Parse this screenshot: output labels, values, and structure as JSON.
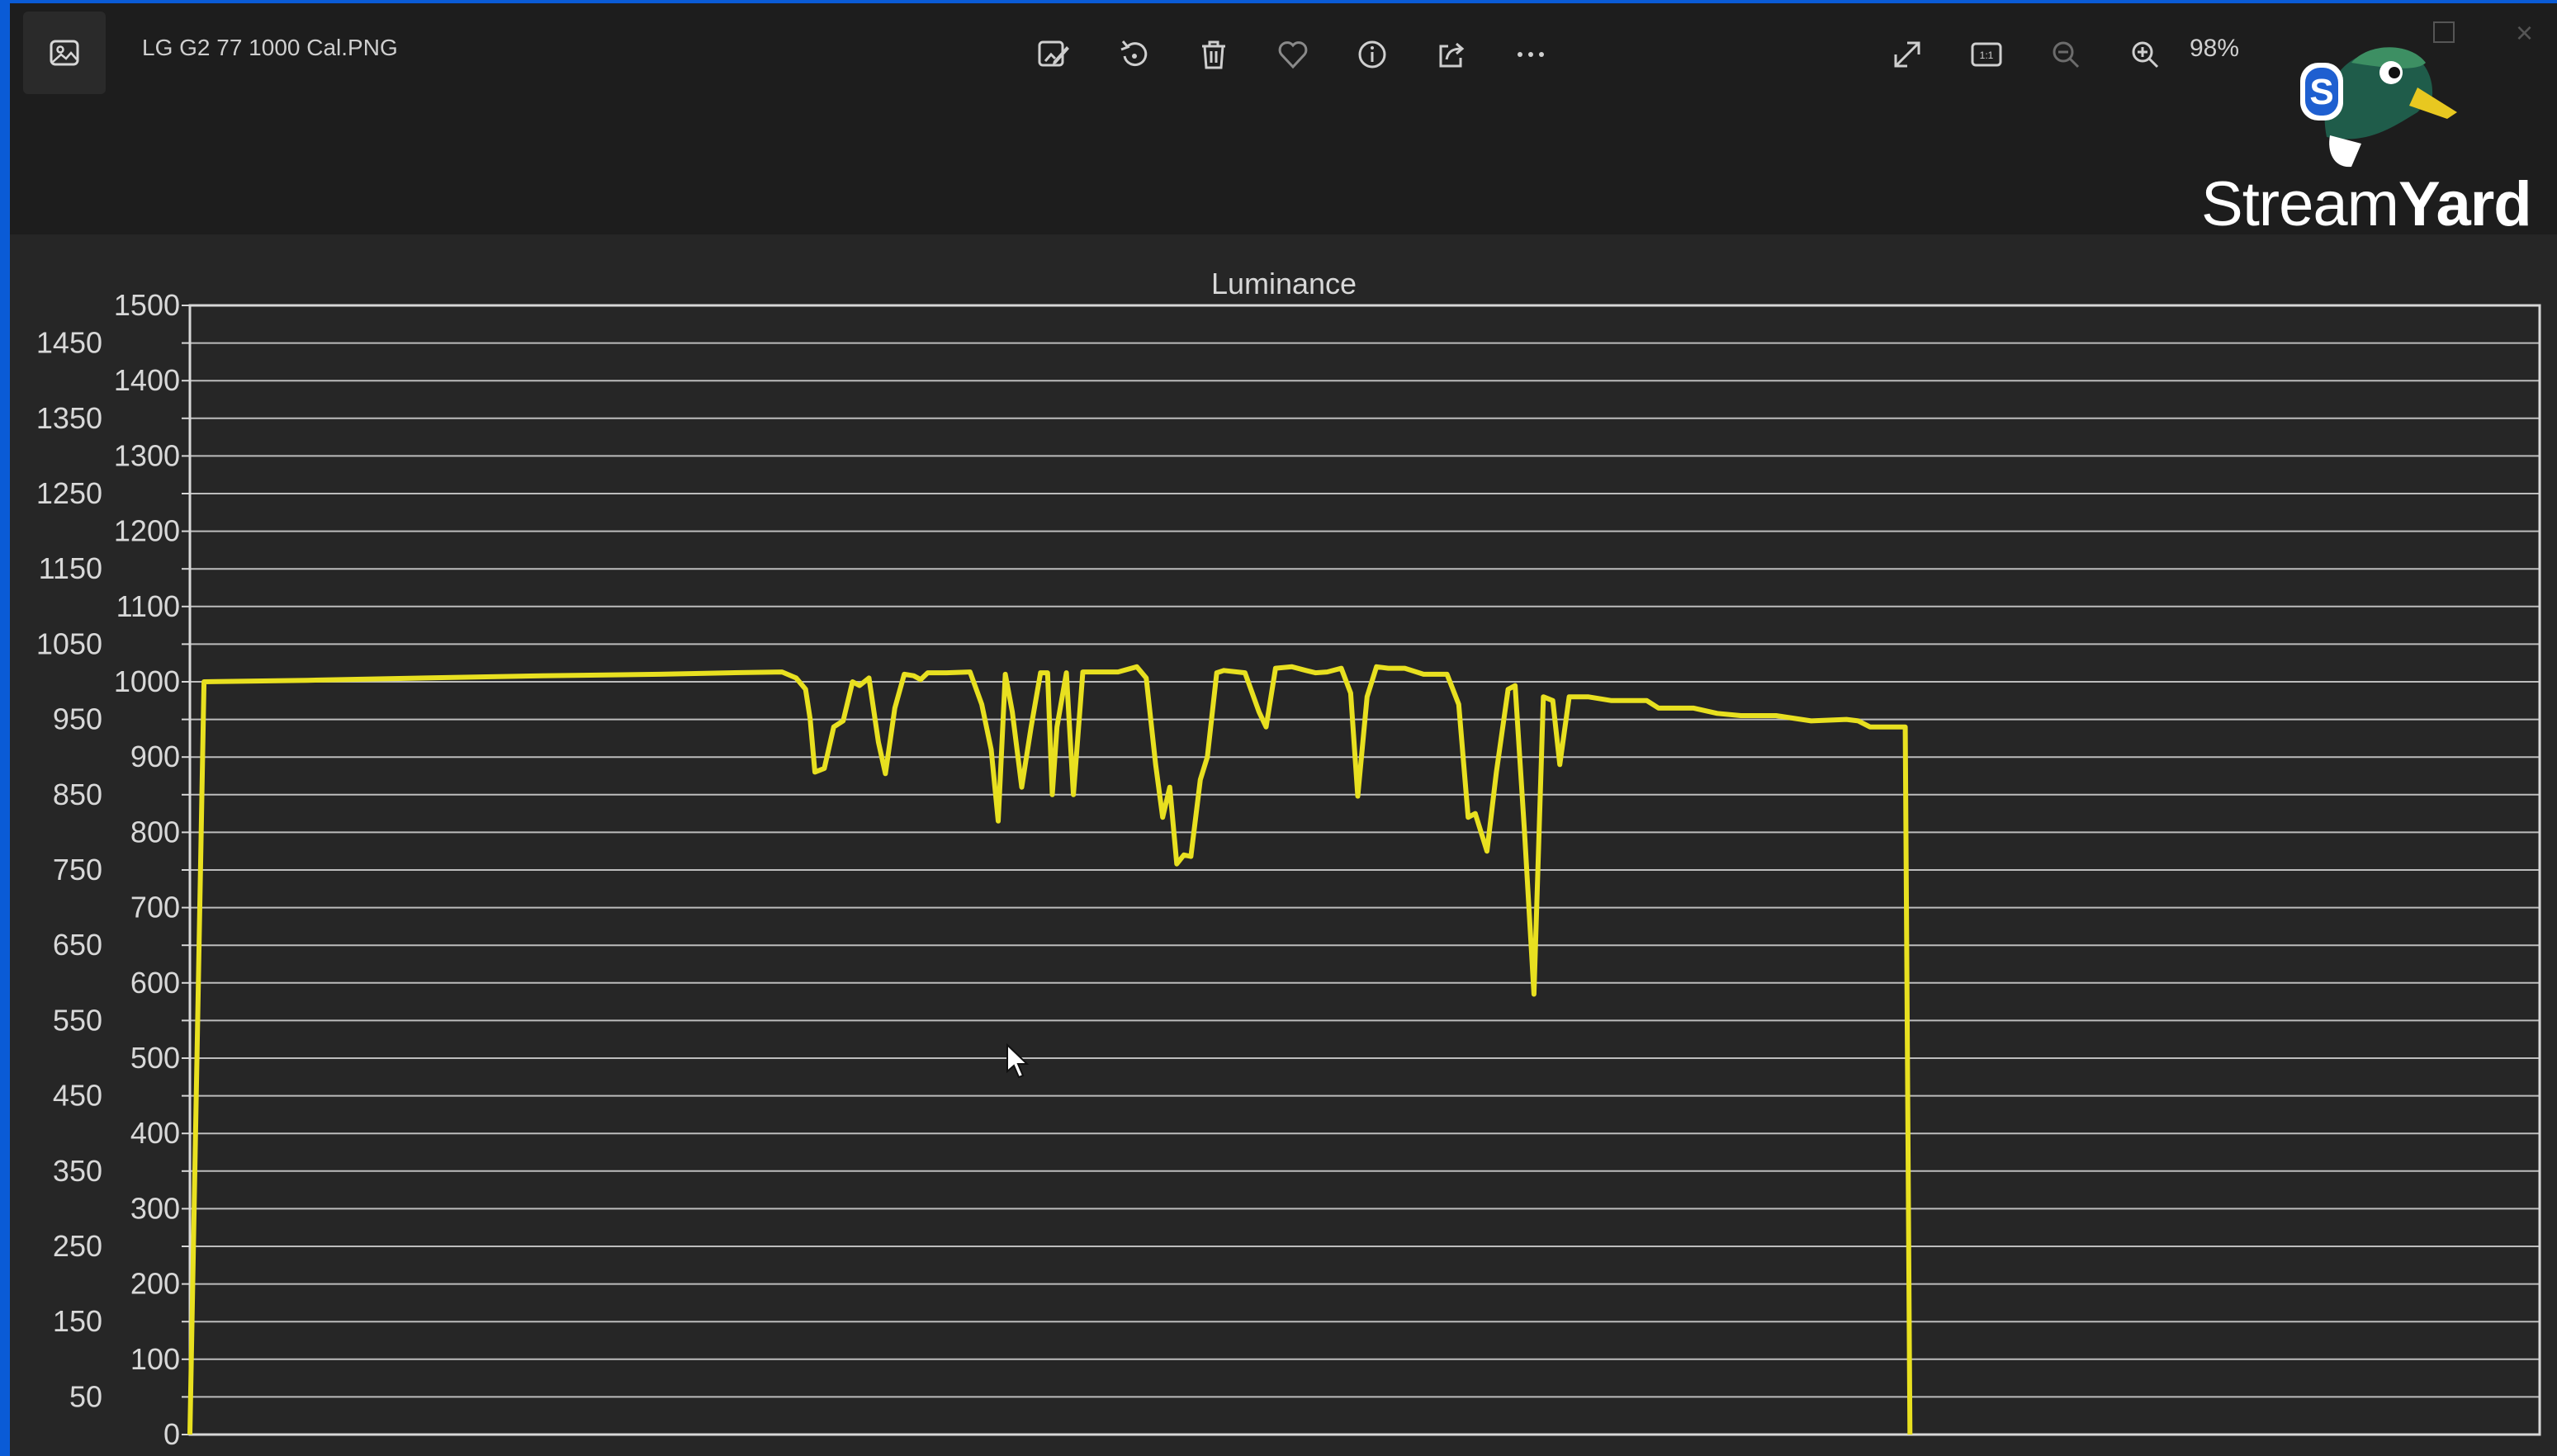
{
  "titlebar": {
    "file_name": "LG G2 77 1000 Cal.PNG",
    "zoom_level": "98%",
    "tools": [
      {
        "name": "edit-image-icon"
      },
      {
        "name": "rotate-icon"
      },
      {
        "name": "delete-icon"
      },
      {
        "name": "favorite-heart-icon"
      },
      {
        "name": "info-icon"
      },
      {
        "name": "share-icon"
      },
      {
        "name": "more-options-icon"
      },
      {
        "name": "fullscreen-icon"
      },
      {
        "name": "actual-size-icon"
      },
      {
        "name": "zoom-out-icon"
      },
      {
        "name": "zoom-in-icon"
      }
    ],
    "actual_size_label": "1:1"
  },
  "overlay": {
    "brand_light": "Stream",
    "brand_bold": "Yard",
    "badge_letter": "S"
  },
  "colors": {
    "line": "#e8e020",
    "grid": "#d8d8d8",
    "axis_text": "#d8d8d8",
    "background": "#262626",
    "titlebar": "#1d1d1d",
    "brand_blue": "#0a5bd6"
  },
  "chart_data": {
    "type": "line",
    "title": "Luminance",
    "xlabel": "",
    "ylabel": "",
    "ylim": [
      0,
      1500
    ],
    "yticks": [
      0,
      50,
      100,
      150,
      200,
      250,
      300,
      350,
      400,
      450,
      500,
      550,
      600,
      650,
      700,
      750,
      800,
      850,
      900,
      950,
      1000,
      1050,
      1100,
      1150,
      1200,
      1250,
      1300,
      1350,
      1400,
      1450,
      1500
    ],
    "grid": true,
    "legend": "none",
    "xlim": [
      0,
      1000
    ],
    "series": [
      {
        "values": [
          [
            0,
            0
          ],
          [
            6,
            1000
          ],
          [
            50,
            1002
          ],
          [
            100,
            1005
          ],
          [
            150,
            1008
          ],
          [
            200,
            1010
          ],
          [
            230,
            1012
          ],
          [
            252,
            1013
          ],
          [
            258,
            1005
          ],
          [
            262,
            990
          ],
          [
            264,
            950
          ],
          [
            266,
            880
          ],
          [
            270,
            885
          ],
          [
            274,
            940
          ],
          [
            278,
            948
          ],
          [
            282,
            1000
          ],
          [
            285,
            995
          ],
          [
            289,
            1005
          ],
          [
            293,
            920
          ],
          [
            296,
            878
          ],
          [
            300,
            965
          ],
          [
            304,
            1010
          ],
          [
            308,
            1008
          ],
          [
            311,
            1003
          ],
          [
            314,
            1012
          ],
          [
            322,
            1012
          ],
          [
            332,
            1013
          ],
          [
            337,
            970
          ],
          [
            341,
            910
          ],
          [
            344,
            815
          ],
          [
            347,
            1010
          ],
          [
            350,
            960
          ],
          [
            354,
            860
          ],
          [
            358,
            940
          ],
          [
            362,
            1012
          ],
          [
            365,
            1012
          ],
          [
            367,
            850
          ],
          [
            369,
            940
          ],
          [
            373,
            1012
          ],
          [
            376,
            850
          ],
          [
            380,
            1013
          ],
          [
            395,
            1013
          ],
          [
            403,
            1020
          ],
          [
            407,
            1005
          ],
          [
            411,
            890
          ],
          [
            414,
            820
          ],
          [
            417,
            860
          ],
          [
            420,
            758
          ],
          [
            423,
            770
          ],
          [
            426,
            768
          ],
          [
            430,
            870
          ],
          [
            433,
            900
          ],
          [
            437,
            1012
          ],
          [
            440,
            1015
          ],
          [
            449,
            1012
          ],
          [
            455,
            960
          ],
          [
            458,
            940
          ],
          [
            462,
            1018
          ],
          [
            469,
            1020
          ],
          [
            475,
            1015
          ],
          [
            479,
            1012
          ],
          [
            484,
            1013
          ],
          [
            490,
            1018
          ],
          [
            494,
            985
          ],
          [
            497,
            848
          ],
          [
            501,
            980
          ],
          [
            505,
            1020
          ],
          [
            510,
            1018
          ],
          [
            517,
            1018
          ],
          [
            525,
            1010
          ],
          [
            535,
            1010
          ],
          [
            540,
            970
          ],
          [
            544,
            820
          ],
          [
            547,
            825
          ],
          [
            552,
            775
          ],
          [
            556,
            880
          ],
          [
            561,
            990
          ],
          [
            564,
            995
          ],
          [
            568,
            800
          ],
          [
            572,
            585
          ],
          [
            576,
            980
          ],
          [
            580,
            975
          ],
          [
            583,
            890
          ],
          [
            587,
            980
          ],
          [
            595,
            980
          ],
          [
            605,
            975
          ],
          [
            620,
            975
          ],
          [
            625,
            965
          ],
          [
            640,
            965
          ],
          [
            650,
            958
          ],
          [
            660,
            955
          ],
          [
            675,
            955
          ],
          [
            690,
            948
          ],
          [
            705,
            950
          ],
          [
            710,
            948
          ],
          [
            715,
            940
          ],
          [
            730,
            940
          ],
          [
            732,
            0
          ]
        ]
      }
    ]
  }
}
